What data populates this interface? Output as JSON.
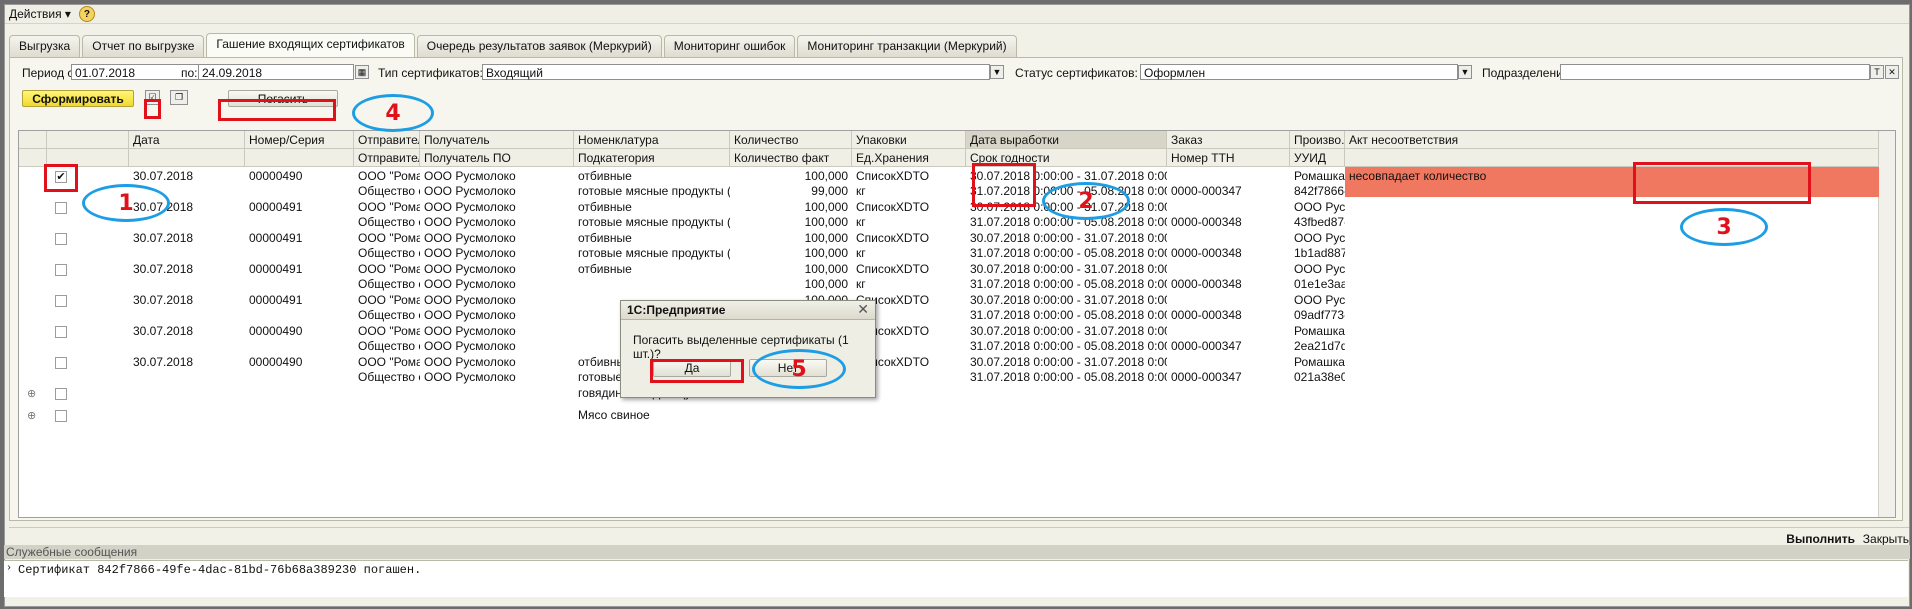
{
  "menu": {
    "actions": "Действия",
    "help": "?"
  },
  "tabs": [
    {
      "label": "Выгрузка",
      "active": false
    },
    {
      "label": "Отчет по выгрузке",
      "active": false
    },
    {
      "label": "Гашение входящих сертификатов",
      "active": true
    },
    {
      "label": "Очередь результатов заявок (Меркурий)",
      "active": false
    },
    {
      "label": "Мониторинг ошибок",
      "active": false
    },
    {
      "label": "Мониторинг транзакции (Меркурий)",
      "active": false
    }
  ],
  "filters": {
    "period_from_label": "Период с:",
    "period_from": "01.07.2018",
    "period_to_label": "по:",
    "period_to": "24.09.2018",
    "cert_type_label": "Тип сертификатов:",
    "cert_type": "Входящий",
    "cert_status_label": "Статус сертификатов:",
    "cert_status": "Оформлен",
    "division_label": "Подразделение:",
    "division": ""
  },
  "toolbar": {
    "form_label": "Сформировать",
    "redeem_label": "Погасить"
  },
  "columns": {
    "row1": [
      "Дата",
      "Номер/Серия",
      "Отправитель",
      "Получатель",
      "Номенклатура",
      "Количество",
      "Упаковки",
      "Дата выработки",
      "Заказ",
      "Произво...",
      "Акт несоответствия"
    ],
    "row2": [
      "Отправитель...",
      "Получатель ПО",
      "Подкатегория",
      "Количество факт",
      "Ед.Хранения",
      "Срок годности",
      "Номер ТТН",
      "УУИД"
    ]
  },
  "rows": [
    {
      "checked": true,
      "date": "30.07.2018",
      "number": "00000490",
      "sender": "ООО \"Рома...",
      "receiver": "ООО Русмолоко",
      "nom": "отбивные",
      "qty": "100,000",
      "pack": "СписокXDTO",
      "prod_date": "30.07.2018 0:00:00 - 31.07.2018 0:00:00",
      "order": "",
      "maker": "Ромашка",
      "act": "несовпадает количество",
      "sender2": "Общество с...",
      "receiver2": "ООО Русмолоко",
      "subcat": "готовые мясные продукты (1601)",
      "qty_fact": "99,000",
      "unit": "кг",
      "expiry": "31.07.2018 0:00:00 - 05.08.2018 0:00:00",
      "ttn": "0000-000347",
      "uuid": "842f7866-..."
    },
    {
      "checked": false,
      "date": "30.07.2018",
      "number": "00000491",
      "sender": "ООО \"Рома...",
      "receiver": "ООО Русмолоко",
      "nom": "отбивные",
      "qty": "100,000",
      "pack": "СписокXDTO",
      "prod_date": "30.07.2018 0:00:00 - 31.07.2018 0:00:00",
      "order": "",
      "maker": "ООО Рус...",
      "act": "",
      "sender2": "Общество с...",
      "receiver2": "ООО Русмолоко",
      "subcat": "готовые мясные продукты (1601)",
      "qty_fact": "100,000",
      "unit": "кг",
      "expiry": "31.07.2018 0:00:00 - 05.08.2018 0:00:00",
      "ttn": "0000-000348",
      "uuid": "43fbed87-..."
    },
    {
      "checked": false,
      "date": "30.07.2018",
      "number": "00000491",
      "sender": "ООО \"Рома...",
      "receiver": "ООО Русмолоко",
      "nom": "отбивные",
      "qty": "100,000",
      "pack": "СписокXDTO",
      "prod_date": "30.07.2018 0:00:00 - 31.07.2018 0:00:00",
      "order": "",
      "maker": "ООО Рус...",
      "act": "",
      "sender2": "Общество с...",
      "receiver2": "ООО Русмолоко",
      "subcat": "готовые мясные продукты (1601)",
      "qty_fact": "100,000",
      "unit": "кг",
      "expiry": "31.07.2018 0:00:00 - 05.08.2018 0:00:00",
      "ttn": "0000-000348",
      "uuid": "1b1ad887..."
    },
    {
      "checked": false,
      "date": "30.07.2018",
      "number": "00000491",
      "sender": "ООО \"Рома...",
      "receiver": "ООО Русмолоко",
      "nom": "отбивные",
      "qty": "100,000",
      "pack": "СписокXDTO",
      "prod_date": "30.07.2018 0:00:00 - 31.07.2018 0:00:00",
      "order": "",
      "maker": "ООО Рус...",
      "act": "",
      "sender2": "Общество с...",
      "receiver2": "ООО Русмолоко",
      "subcat": "",
      "qty_fact": "100,000",
      "unit": "кг",
      "expiry": "31.07.2018 0:00:00 - 05.08.2018 0:00:00",
      "ttn": "0000-000348",
      "uuid": "01e1e3aa..."
    },
    {
      "checked": false,
      "date": "30.07.2018",
      "number": "00000491",
      "sender": "ООО \"Рома...",
      "receiver": "ООО Русмолоко",
      "nom": "",
      "qty": "100,000",
      "pack": "СписокXDTO",
      "prod_date": "30.07.2018 0:00:00 - 31.07.2018 0:00:00",
      "order": "",
      "maker": "ООО Рус...",
      "act": "",
      "sender2": "Общество с...",
      "receiver2": "ООО Русмолоко",
      "subcat": "",
      "qty_fact": "100,000",
      "unit": "кг",
      "expiry": "31.07.2018 0:00:00 - 05.08.2018 0:00:00",
      "ttn": "0000-000348",
      "uuid": "09adf773-..."
    },
    {
      "checked": false,
      "date": "30.07.2018",
      "number": "00000490",
      "sender": "ООО \"Рома...",
      "receiver": "ООО Русмолоко",
      "nom": "",
      "qty": "100,000",
      "pack": "СписокXDTO",
      "prod_date": "30.07.2018 0:00:00 - 31.07.2018 0:00:00",
      "order": "",
      "maker": "Ромашка",
      "act": "",
      "sender2": "Общество с...",
      "receiver2": "ООО Русмолоко",
      "subcat": "",
      "qty_fact": "100,000",
      "unit": "кг",
      "expiry": "31.07.2018 0:00:00 - 05.08.2018 0:00:00",
      "ttn": "0000-000347",
      "uuid": "2ea21d7d..."
    },
    {
      "checked": false,
      "date": "30.07.2018",
      "number": "00000490",
      "sender": "ООО \"Рома...",
      "receiver": "ООО Русмолоко",
      "nom": "отбивные",
      "qty": "100,000",
      "pack": "СписокXDTO",
      "prod_date": "30.07.2018 0:00:00 - 31.07.2018 0:00:00",
      "order": "",
      "maker": "Ромашка",
      "act": "",
      "sender2": "Общество с...",
      "receiver2": "ООО Русмолоко",
      "subcat": "готовые мясные продукты (1601)",
      "qty_fact": "100,000",
      "unit": "кг",
      "expiry": "31.07.2018 0:00:00 - 05.08.2018 0:00:00",
      "ttn": "0000-000347",
      "uuid": "021a38e0..."
    }
  ],
  "group_rows": [
    "говядина по французски",
    "Мясо свиное"
  ],
  "dialog": {
    "title": "1С:Предприятие",
    "message": "Погасить выделенные сертификаты (1 шт.)?",
    "yes": "Да",
    "no": "Нет"
  },
  "annotations": [
    "1",
    "2",
    "3",
    "4",
    "5"
  ],
  "bottom": {
    "execute": "Выполнить",
    "close": "Закрыть"
  },
  "messages": {
    "title": "Служебные сообщения",
    "line": "Сертификат 842f7866-49fe-4dac-81bd-76b68a389230 погашен."
  },
  "colors": {
    "highlight": "#f07860",
    "annotation_red": "#e1111c",
    "annotation_blue": "#1d9de3"
  }
}
